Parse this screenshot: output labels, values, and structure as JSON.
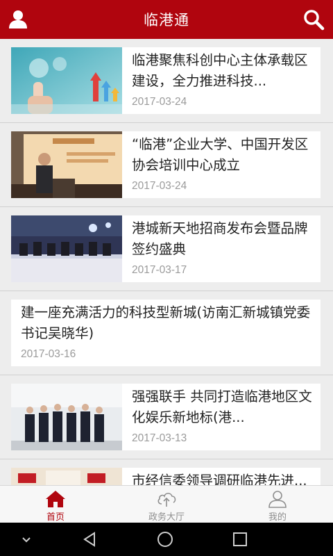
{
  "header": {
    "title": "临港通",
    "bg_color": "#b0050e",
    "left_icon": "user-icon",
    "right_icon": "search-icon"
  },
  "news": [
    {
      "title": "临港聚焦科创中心主体承载区建设，全力推进科技...",
      "date": "2017-03-24",
      "has_image": true,
      "image": "tech-growth-arrows"
    },
    {
      "title": "“临港”企业大学、中国开发区协会培训中心成立",
      "date": "2017-03-24",
      "has_image": true,
      "image": "speaker-at-podium"
    },
    {
      "title": "港城新天地招商发布会暨品牌签约盛典",
      "date": "2017-03-17",
      "has_image": true,
      "image": "conference-table"
    },
    {
      "title": "建一座充满活力的科技型新城(访南汇新城镇党委书记吴晓华)",
      "date": "2017-03-16",
      "has_image": false
    },
    {
      "title": "强强联手 共同打造临港地区文化娱乐新地标(港...",
      "date": "2017-03-13",
      "has_image": true,
      "image": "group-photo"
    },
    {
      "title": "市经信委领导调研临港先进...",
      "date": "",
      "has_image": true,
      "image": "meeting-room"
    }
  ],
  "tabs": [
    {
      "label": "首页",
      "icon": "home-icon",
      "active": true
    },
    {
      "label": "政务大厅",
      "icon": "cloud-upload-icon",
      "active": false
    },
    {
      "label": "我的",
      "icon": "person-icon",
      "active": false
    }
  ],
  "system_nav": [
    "down-chevron-icon",
    "back-icon",
    "home-circle-icon",
    "recents-icon"
  ],
  "colors": {
    "accent": "#b0050e",
    "date": "#9a9a9a",
    "inactive_tab": "#8e8e8e"
  }
}
